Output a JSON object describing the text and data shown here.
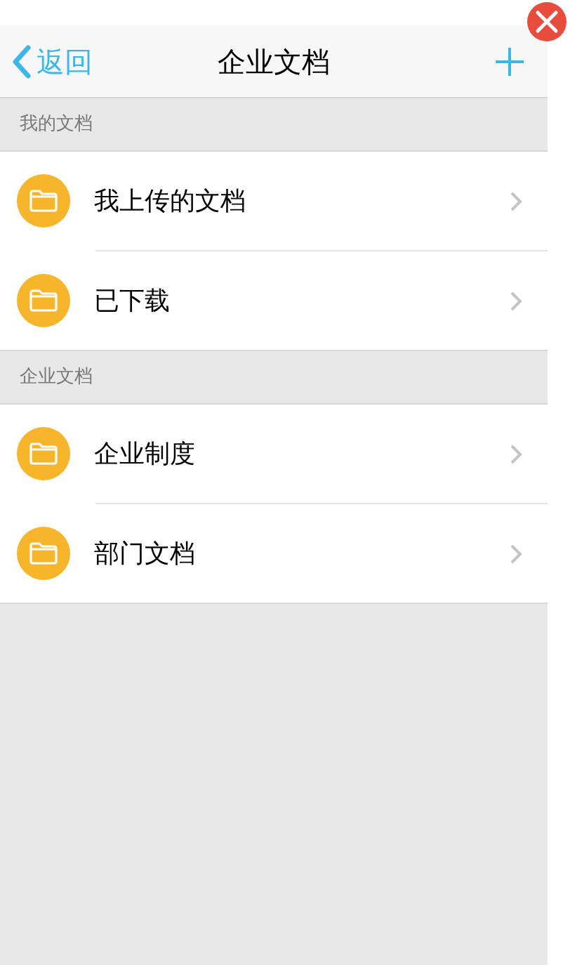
{
  "header": {
    "back": "返回",
    "title": "企业文档"
  },
  "sections": [
    {
      "title": "我的文档",
      "items": [
        {
          "label": "我上传的文档"
        },
        {
          "label": "已下载"
        }
      ]
    },
    {
      "title": "企业文档",
      "items": [
        {
          "label": "企业制度"
        },
        {
          "label": "部门文档"
        }
      ]
    }
  ]
}
